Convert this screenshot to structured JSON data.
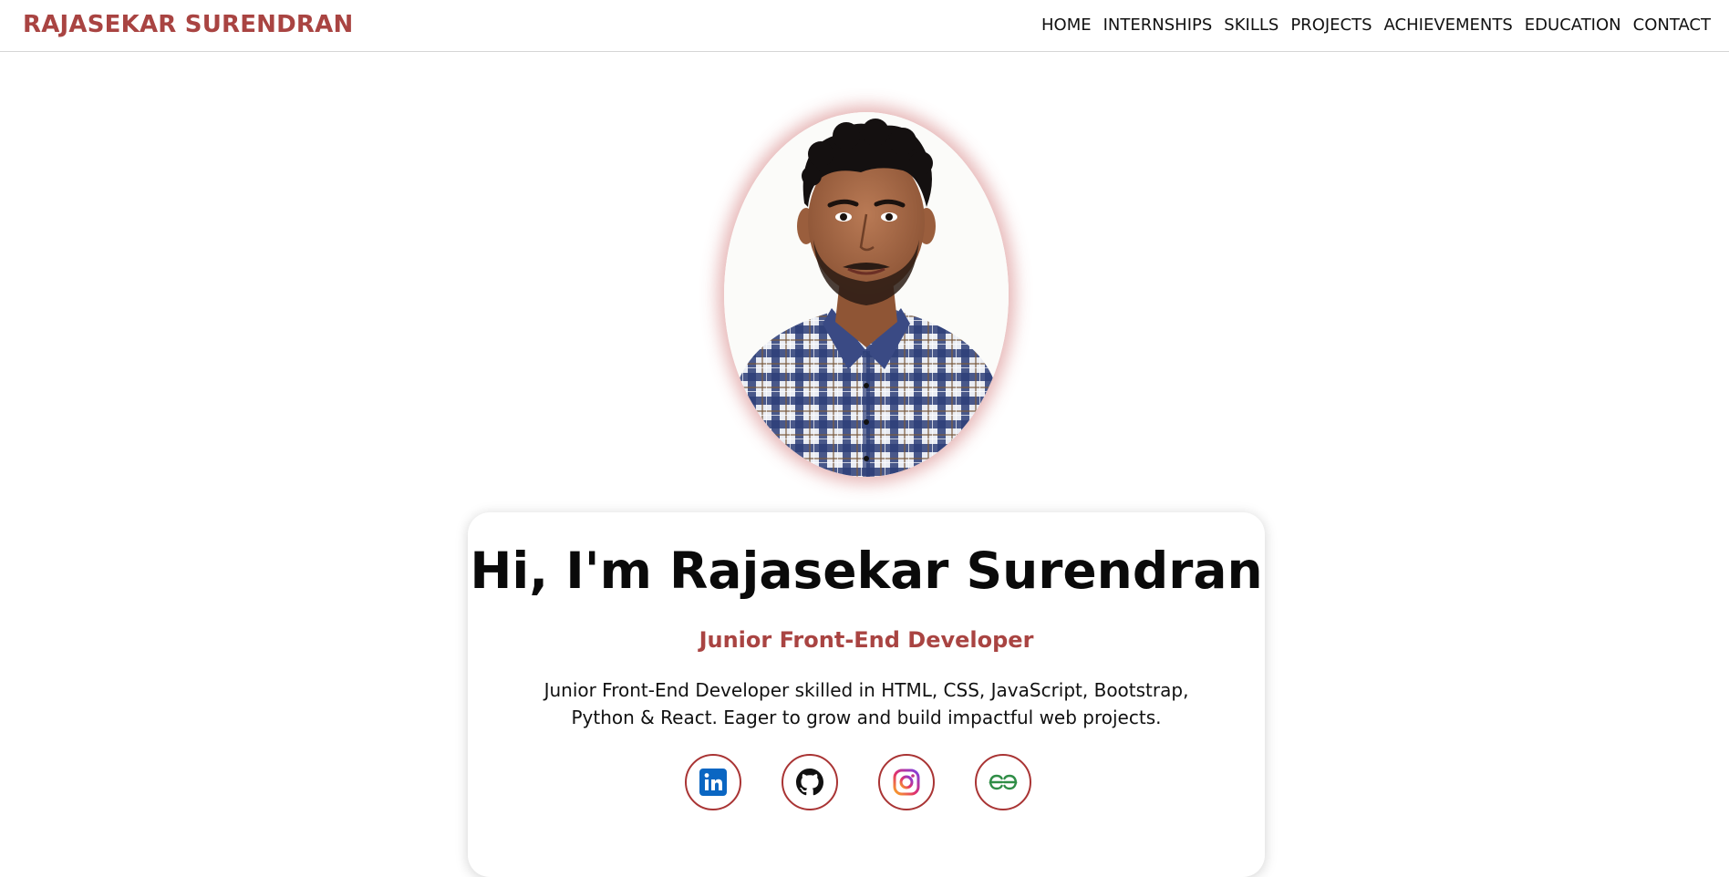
{
  "brand": "RAJASEKAR SURENDRAN",
  "nav": {
    "items": [
      {
        "label": "HOME"
      },
      {
        "label": "INTERNSHIPS"
      },
      {
        "label": "SKILLS"
      },
      {
        "label": "PROJECTS"
      },
      {
        "label": "ACHIEVEMENTS"
      },
      {
        "label": "EDUCATION"
      },
      {
        "label": "CONTACT"
      }
    ]
  },
  "hero": {
    "greeting": "Hi, I'm Rajasekar Surendran",
    "role": "Junior Front-End Developer",
    "bio": "Junior Front-End Developer skilled in HTML, CSS, JavaScript, Bootstrap, Python & React. Eager to grow and build impactful web projects."
  },
  "socials": [
    {
      "icon": "linkedin-icon"
    },
    {
      "icon": "github-icon"
    },
    {
      "icon": "instagram-icon"
    },
    {
      "icon": "geeksforgeeks-icon"
    }
  ],
  "colors": {
    "accent": "#a94442",
    "social_border": "#a93434",
    "linkedin": "#0a66c2",
    "geeksforgeeks": "#2f8d46"
  }
}
